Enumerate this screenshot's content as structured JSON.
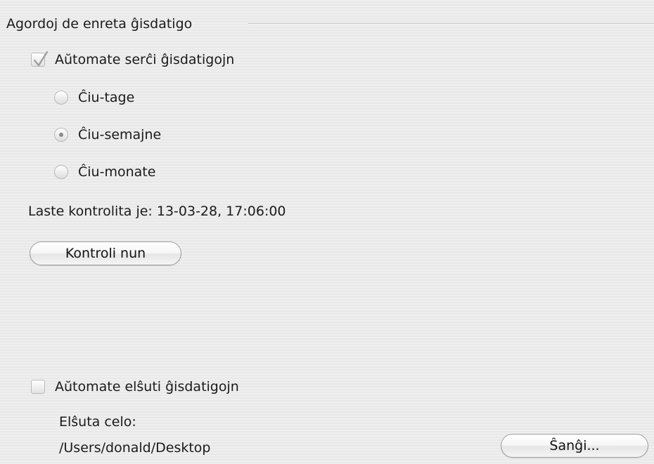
{
  "group": {
    "title": "Agordoj de enreta ĝisdatigo"
  },
  "auto_check": {
    "label": "Aŭtomate serĉi ĝisdatigojn",
    "checked": true,
    "icon": "checkmark-icon"
  },
  "frequency": {
    "selected": "weekly",
    "options": [
      {
        "id": "daily",
        "label": "Ĉiu-tage",
        "selected": false
      },
      {
        "id": "weekly",
        "label": "Ĉiu-semajne",
        "selected": true
      },
      {
        "id": "monthly",
        "label": "Ĉiu-monate",
        "selected": false
      }
    ]
  },
  "last_check": {
    "text": "Laste kontrolita je: 13-03-28, 17:06:00"
  },
  "check_now_button": {
    "label": "Kontroli nun"
  },
  "auto_download": {
    "label": "Aŭtomate elŝuti ĝisdatigojn",
    "checked": false
  },
  "download_target": {
    "label": "Elŝuta celo:",
    "path": "/Users/donald/Desktop"
  },
  "change_button": {
    "label": "Ŝanĝi..."
  },
  "colors": {
    "background": "#ececec",
    "text": "#1a1a1a",
    "control_border": "#b9b9b9"
  }
}
